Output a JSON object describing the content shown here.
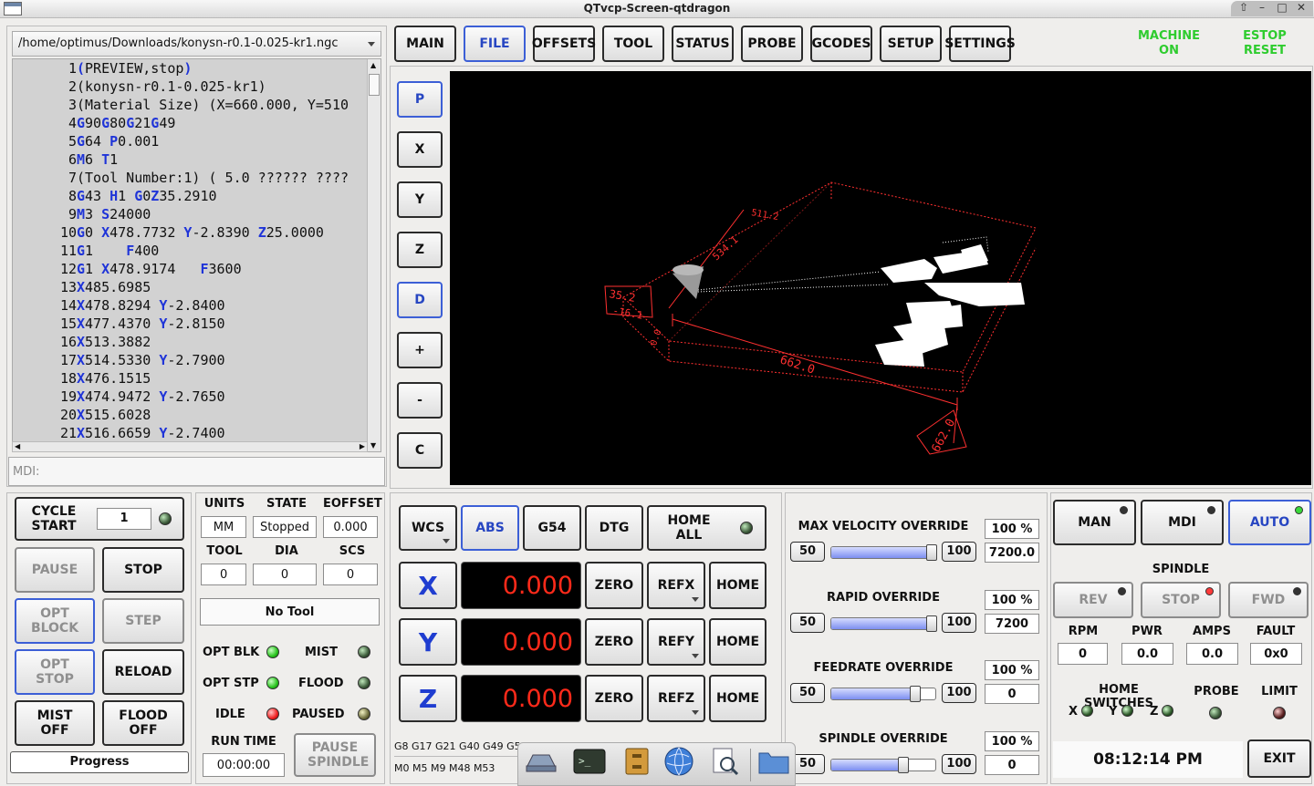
{
  "window": {
    "title": "QTvcp-Screen-qtdragon"
  },
  "file_panel": {
    "path": "/home/optimus/Downloads/konysn-r0.1-0.025-kr1.ngc",
    "mdi_label": "MDI:"
  },
  "gcode": [
    {
      "n": "1",
      "t": "(PREVIEW,stop)"
    },
    {
      "n": "2",
      "t": "(konysn-r0.1-0.025-kr1)"
    },
    {
      "n": "3",
      "t": "(Material Size) (X=660.000, Y=510"
    },
    {
      "n": "4",
      "t": "G90G80G21G49"
    },
    {
      "n": "5",
      "t": "G64 P0.001"
    },
    {
      "n": "6",
      "t": "M6 T1"
    },
    {
      "n": "7",
      "t": "(Tool Number:1) ( 5.0 ?????? ????"
    },
    {
      "n": "8",
      "t": "G43 H1 G0Z35.2910"
    },
    {
      "n": "9",
      "t": "M3 S24000"
    },
    {
      "n": "10",
      "t": "G0 X478.7732 Y-2.8390 Z25.0000"
    },
    {
      "n": "11",
      "t": "G1    F400"
    },
    {
      "n": "12",
      "t": "G1 X478.9174   F3600"
    },
    {
      "n": "13",
      "t": "X485.6985"
    },
    {
      "n": "14",
      "t": "X478.8294 Y-2.8400"
    },
    {
      "n": "15",
      "t": "X477.4370 Y-2.8150"
    },
    {
      "n": "16",
      "t": "X513.3882"
    },
    {
      "n": "17",
      "t": "X514.5330 Y-2.7900"
    },
    {
      "n": "18",
      "t": "X476.1515"
    },
    {
      "n": "19",
      "t": "X474.9472 Y-2.7650"
    },
    {
      "n": "20",
      "t": "X515.6028"
    },
    {
      "n": "21",
      "t": "X516.6659 Y-2.7400"
    }
  ],
  "tabs": [
    "MAIN",
    "FILE",
    "OFFSETS",
    "TOOL",
    "STATUS",
    "PROBE",
    "GCODES",
    "SETUP",
    "SETTINGS"
  ],
  "active_tab": "FILE",
  "machine": {
    "line1": "MACHINE",
    "line2": "ON"
  },
  "estop": {
    "line1": "ESTOP",
    "line2": "RESET"
  },
  "view_buttons": [
    "P",
    "X",
    "Y",
    "Z",
    "D",
    "+",
    "-",
    "C"
  ],
  "preview_labels": {
    "dim_x": "662.0",
    "dim_x2": "662.0",
    "dim_y": "511.2",
    "dim_y2": "534.1",
    "dim_z1": "35.2",
    "dim_z2": "-16.1",
    "zero": "0.0"
  },
  "cycle": {
    "start_label": "CYCLE START",
    "start_value": "1",
    "pause": "PAUSE",
    "stop": "STOP",
    "opt_block": "OPT BLOCK",
    "step": "STEP",
    "opt_stop": "OPT STOP",
    "reload": "RELOAD",
    "mist_off": "MIST OFF",
    "flood_off": "FLOOD OFF",
    "progress": "Progress"
  },
  "status_box": {
    "units_label": "UNITS",
    "units": "MM",
    "state_label": "STATE",
    "state": "Stopped",
    "eoffset_label": "EOFFSET",
    "eoffset": "0.000",
    "tool_label": "TOOL",
    "tool": "0",
    "dia_label": "DIA",
    "dia": "0",
    "scs_label": "SCS",
    "scs": "0",
    "tool_name": "No Tool",
    "opt_blk": "OPT BLK",
    "mist": "MIST",
    "opt_stp": "OPT STP",
    "flood": "FLOOD",
    "idle": "IDLE",
    "paused": "PAUSED",
    "run_time_label": "RUN TIME",
    "run_time": "00:00:00",
    "pause_spindle": "PAUSE SPINDLE"
  },
  "dro": {
    "wcs": "WCS",
    "abs": "ABS",
    "g54": "G54",
    "dtg": "DTG",
    "home_all": "HOME ALL",
    "axes": [
      {
        "axis": "X",
        "value": "0.000",
        "ref": "REFX"
      },
      {
        "axis": "Y",
        "value": "0.000",
        "ref": "REFY"
      },
      {
        "axis": "Z",
        "value": "0.000",
        "ref": "REFZ"
      }
    ],
    "zero": "ZERO",
    "home": "HOME",
    "gcodes_line": "G8 G17 G21 G40 G49 G54",
    "mcodes_line": "M0 M5 M9 M48 M53"
  },
  "overrides": [
    {
      "label": "MAX VELOCITY OVERRIDE",
      "min": "50",
      "max": "100",
      "pct": "100 %",
      "value": "7200.0",
      "level": 1.0
    },
    {
      "label": "RAPID OVERRIDE",
      "min": "50",
      "max": "100",
      "pct": "100 %",
      "value": "7200",
      "level": 1.0
    },
    {
      "label": "FEEDRATE OVERRIDE",
      "min": "50",
      "max": "100",
      "pct": "100 %",
      "value": "0",
      "level": 0.83
    },
    {
      "label": "SPINDLE OVERRIDE",
      "min": "50",
      "max": "100",
      "pct": "100 %",
      "value": "0",
      "level": 0.7
    }
  ],
  "modes": {
    "man": "MAN",
    "mdi": "MDI",
    "auto": "AUTO"
  },
  "spindle": {
    "title": "SPINDLE",
    "rev": "REV",
    "stop": "STOP",
    "fwd": "FWD",
    "rpm_label": "RPM",
    "rpm": "0",
    "pwr_label": "PWR",
    "pwr": "0.0",
    "amps_label": "AMPS",
    "amps": "0.0",
    "fault_label": "FAULT",
    "fault": "0x0"
  },
  "switches": {
    "home_label": "HOME SWITCHES",
    "x": "X",
    "y": "Y",
    "z": "Z",
    "probe": "PROBE",
    "limit": "LIMIT"
  },
  "clock": "08:12:14 PM",
  "exit": "EXIT",
  "colors": {
    "accent_blue": "#2746c2",
    "machine_green": "#2ecc2e",
    "dro_red": "#ff2a1a"
  }
}
